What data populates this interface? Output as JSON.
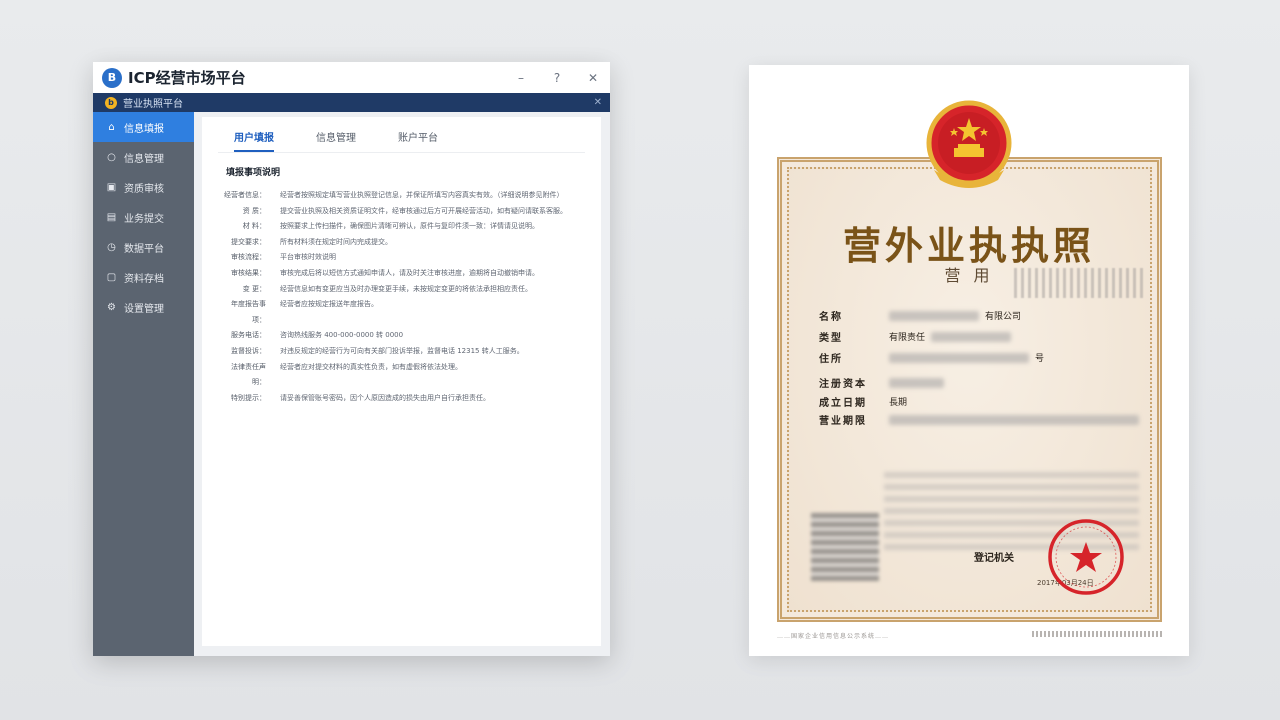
{
  "app": {
    "title": "ICP经营市场平台",
    "logo_letter": "B",
    "subbar_label": "营业执照平台",
    "win_minimize": "–",
    "win_help": "?",
    "win_close": "✕",
    "subbar_close": "✕"
  },
  "sidebar": {
    "items": [
      {
        "label": "信息填报",
        "icon": "home-icon",
        "glyph": "⌂",
        "active": true
      },
      {
        "label": "信息管理",
        "icon": "circle-icon",
        "glyph": "○",
        "active": false
      },
      {
        "label": "资质审核",
        "icon": "image-icon",
        "glyph": "▣",
        "active": false
      },
      {
        "label": "业务提交",
        "icon": "list-icon",
        "glyph": "▤",
        "active": false
      },
      {
        "label": "数据平台",
        "icon": "clock-icon",
        "glyph": "◷",
        "active": false
      },
      {
        "label": "资料存档",
        "icon": "doc-icon",
        "glyph": "▢",
        "active": false
      },
      {
        "label": "设置管理",
        "icon": "settings-icon",
        "glyph": "⚙",
        "active": false
      }
    ]
  },
  "tabs": [
    {
      "label": "用户填报",
      "active": true
    },
    {
      "label": "信息管理",
      "active": false
    },
    {
      "label": "账户平台",
      "active": false
    }
  ],
  "section_title": "填报事项说明",
  "rows": [
    {
      "label": "经营者信息：",
      "value": "经营者按照规定填写营业执照登记信息，并保证所填写内容真实有效。（详细说明参见附件）"
    },
    {
      "label": "资  质：",
      "value": "提交营业执照及相关资质证明文件，经审核通过后方可开展经营活动，如有疑问请联系客服。"
    },
    {
      "label": "材  料：",
      "value": "按照要求上传扫描件，确保图片清晰可辨认，原件与复印件须一致：详情请见说明。"
    },
    {
      "label": "提交要求：",
      "value": "所有材料须在规定时间内完成提交。"
    },
    {
      "label": "审核流程：",
      "value": "平台审核时效说明"
    },
    {
      "label": "审核结果：",
      "value": "审核完成后将以短信方式通知申请人，请及时关注审核进度，逾期将自动撤销申请。"
    },
    {
      "label": "变  更：",
      "value": "经营信息如有变更应当及时办理变更手续，未按规定变更的将依法承担相应责任。"
    },
    {
      "label": "年度报告事项：",
      "value": "经营者应按规定报送年度报告。"
    },
    {
      "label": "服务电话：",
      "value": "咨询热线服务 400-000-0000 转 0000"
    },
    {
      "label": "监督投诉：",
      "value": "对违反规定的经营行为可向有关部门投诉举报，监督电话 12315 转人工服务。"
    },
    {
      "label": "法律责任声明：",
      "value": "经营者应对提交材料的真实性负责，如有虚假将依法处理。"
    },
    {
      "label": "特别提示：",
      "value": "请妥善保管账号密码，因个人原因造成的损失由用户自行承担责任。"
    }
  ],
  "certificate": {
    "title": "营外业执执照",
    "subtitle": "营 用",
    "fields": [
      {
        "label": "名称",
        "value": "有限公司"
      },
      {
        "label": "类型",
        "value": "有限责任"
      },
      {
        "label": "住所",
        "value": "号"
      },
      {
        "label": "注册资本",
        "value": ""
      },
      {
        "label": "成立日期",
        "value": "長期"
      },
      {
        "label": "营业期限",
        "value": ""
      }
    ],
    "issuer": "登记机关",
    "issue_date": "2017年03月24日",
    "footer_left": "……国家企业信用信息公示系统……"
  },
  "colors": {
    "accent": "#2f7fe0",
    "subbar": "#1f3a66",
    "sidebar": "#5b6470",
    "cert_gold": "#c9a36d",
    "seal_red": "#d6242a"
  }
}
